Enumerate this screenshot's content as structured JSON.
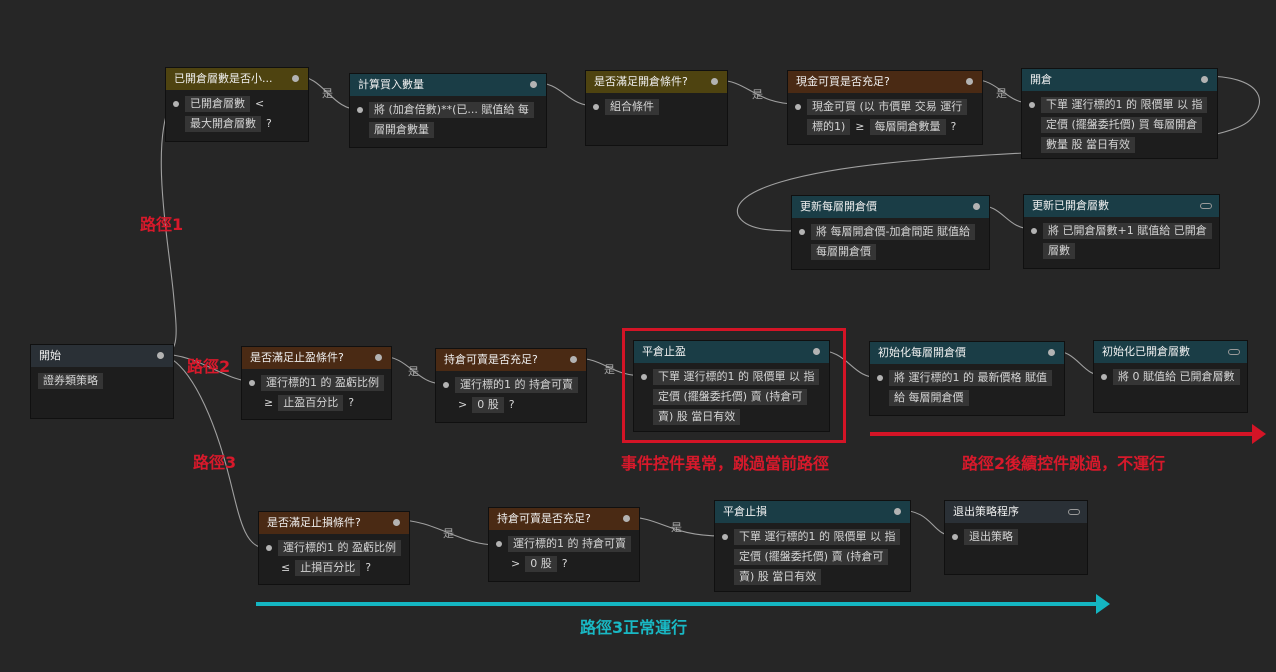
{
  "nodes": {
    "n1": {
      "title": "已開倉層數是否小...",
      "body": [
        "已開倉層數",
        "<",
        "最大開倉層數",
        "?"
      ]
    },
    "n2": {
      "title": "計算買入數量",
      "body": [
        "將 (加倉倍數)**(已... 賦值給 每",
        "層開倉數量"
      ]
    },
    "n3": {
      "title": "是否滿足開倉條件?",
      "body": [
        "組合條件"
      ]
    },
    "n4": {
      "title": "現金可買是否充足?",
      "body": [
        "現金可買 (以 市價單 交易 運行",
        "標的1)",
        "≥",
        "每層開倉數量",
        "?"
      ]
    },
    "n5": {
      "title": "開倉",
      "body": [
        "下單 運行標的1 的 限價單 以 指",
        "定價 (擺盤委托價) 買 每層開倉",
        "數量 股 當日有效"
      ]
    },
    "n6": {
      "title": "更新每層開倉價",
      "body": [
        "將 每層開倉價-加倉間距 賦值給",
        "每層開倉價"
      ]
    },
    "n7": {
      "title": "更新已開倉層數",
      "body": [
        "將 已開倉層數+1 賦值給 已開倉",
        "層數"
      ]
    },
    "start": {
      "title": "開始",
      "body": [
        "證券類策略"
      ]
    },
    "n8": {
      "title": "是否滿足止盈條件?",
      "body": [
        "運行標的1 的 盈虧比例",
        "≥",
        "止盈百分比",
        "?"
      ]
    },
    "n9": {
      "title": "持倉可賣是否充足?",
      "body": [
        ">",
        "0 股",
        "?"
      ]
    },
    "n9_row1": "運行標的1 的 持倉可賣",
    "n10": {
      "title": "平倉止盈",
      "body": [
        "下單 運行標的1 的 限價單 以 指",
        "定價 (擺盤委托價) 賣 (持倉可",
        "賣) 股 當日有效"
      ]
    },
    "n11": {
      "title": "初始化每層開倉價",
      "body": [
        "將 運行標的1 的 最新價格 賦值",
        "給 每層開倉價"
      ]
    },
    "n12": {
      "title": "初始化已開倉層數",
      "body": [
        "將 0 賦值給 已開倉層數"
      ]
    },
    "n13": {
      "title": "是否滿足止損條件?",
      "body": [
        "運行標的1 的 盈虧比例",
        "≤",
        "止損百分比",
        "?"
      ]
    },
    "n14": {
      "title": "持倉可賣是否充足?",
      "body": [
        "運行標的1 的 持倉可賣",
        ">",
        "0 股",
        "?"
      ]
    },
    "n15": {
      "title": "平倉止損",
      "body": [
        "下單 運行標的1 的 限價單 以 指",
        "定價 (擺盤委托價) 賣 (持倉可",
        "賣) 股 當日有效"
      ]
    },
    "n16": {
      "title": "退出策略程序",
      "body": [
        "退出策略"
      ]
    }
  },
  "wire_labels": {
    "yes": "是"
  },
  "annotations": {
    "path1": "路徑1",
    "path2": "路徑2",
    "path3": "路徑3",
    "event_error": "事件控件異常，跳過當前路徑",
    "path2_skip": "路徑2後續控件跳過，不運行",
    "path3_normal": "路徑3正常運行"
  },
  "colors": {
    "background": "#262626",
    "header_condition_gold": "#4e4310",
    "header_action_teal": "#1a3d46",
    "header_condition_brown": "#4a2a14",
    "highlight_red": "#d7192b",
    "highlight_cyan": "#19b8c4"
  }
}
